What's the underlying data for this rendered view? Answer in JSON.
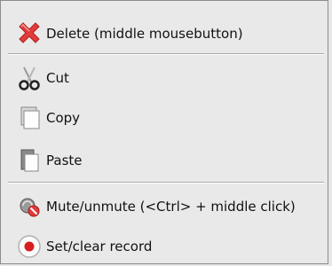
{
  "menu": {
    "items": [
      {
        "label": "Delete (middle mousebutton)",
        "icon": "delete-x-icon"
      },
      {
        "label": "Cut",
        "icon": "scissors-icon"
      },
      {
        "label": "Copy",
        "icon": "copy-page-icon"
      },
      {
        "label": "Paste",
        "icon": "paste-page-icon"
      },
      {
        "label": "Mute/unmute (<Ctrl> + middle click)",
        "icon": "mute-icon"
      },
      {
        "label": "Set/clear record",
        "icon": "record-icon"
      }
    ]
  },
  "colors": {
    "menu_background": "#e9e9e9",
    "delete_red": "#e23b3b",
    "record_red": "#d81e1e"
  }
}
